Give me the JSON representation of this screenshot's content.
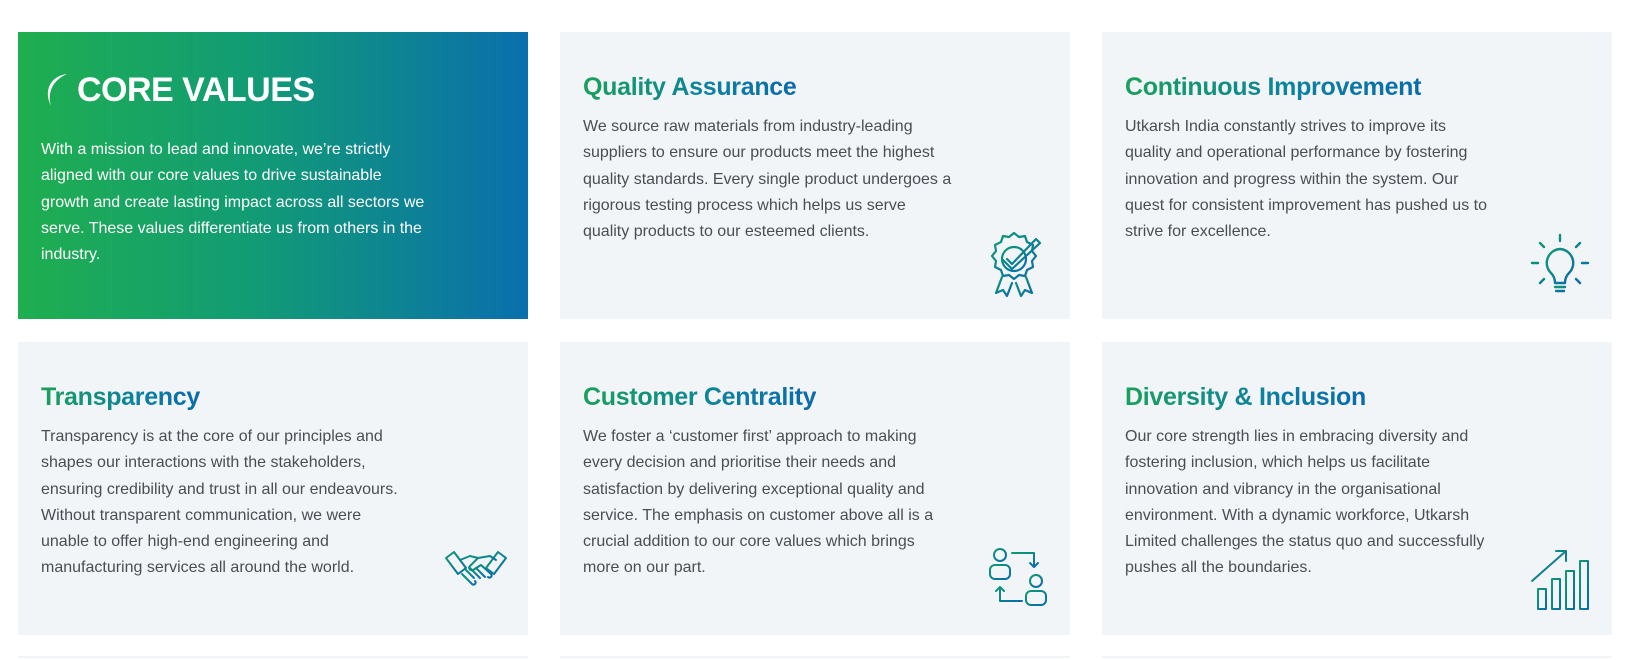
{
  "hero": {
    "title": "CORE VALUES",
    "text": "With a mission to lead and innovate, we’re strictly aligned with our core values to drive sustainable growth and create lasting impact across all sectors we serve. These values differentiate us from others in the industry.",
    "gradient_start": "#1fae4f",
    "gradient_end": "#0a6fae"
  },
  "cards": [
    {
      "title": "Quality Assurance",
      "text": "We source raw materials from industry-leading suppliers to ensure our products meet the highest quality standards. Every single product undergoes a rigorous testing process which helps us serve quality products to our esteemed clients.",
      "icon": "quality-badge-icon"
    },
    {
      "title": "Continuous Improvement",
      "text": "Utkarsh India constantly strives to improve its quality and operational performance by fostering innovation and progress within the system. Our quest for consistent improvement has pushed us to strive for excellence.",
      "icon": "lightbulb-icon"
    },
    {
      "title": "Transparency",
      "text": "Transparency is at the core of our principles and shapes our interactions with the stakeholders, ensuring credibility and trust in all our endeavours. Without transparent communication, we were unable to offer high-end engineering and manufacturing services all around the world.",
      "icon": "handshake-icon"
    },
    {
      "title": "Customer Centrality",
      "text": "We foster a ‘customer first’ approach to making every decision and prioritise their needs and satisfaction by delivering exceptional quality and service. The emphasis on customer above all is a crucial addition to our core values which brings more on our part.",
      "icon": "customer-exchange-icon"
    },
    {
      "title": "Diversity & Inclusion",
      "text": "Our core strength lies in embracing diversity and fostering inclusion, which helps us facilitate innovation and vibrancy in the organisational environment. With a dynamic workforce, Utkarsh Limited challenges the status quo and successfully pushes all the boundaries.",
      "icon": "growth-chart-icon"
    }
  ],
  "colors": {
    "card_background": "#f2f5f8",
    "body_text": "#4a4d52",
    "icon_green": "#0f9a70",
    "icon_blue": "#0a6aac"
  }
}
